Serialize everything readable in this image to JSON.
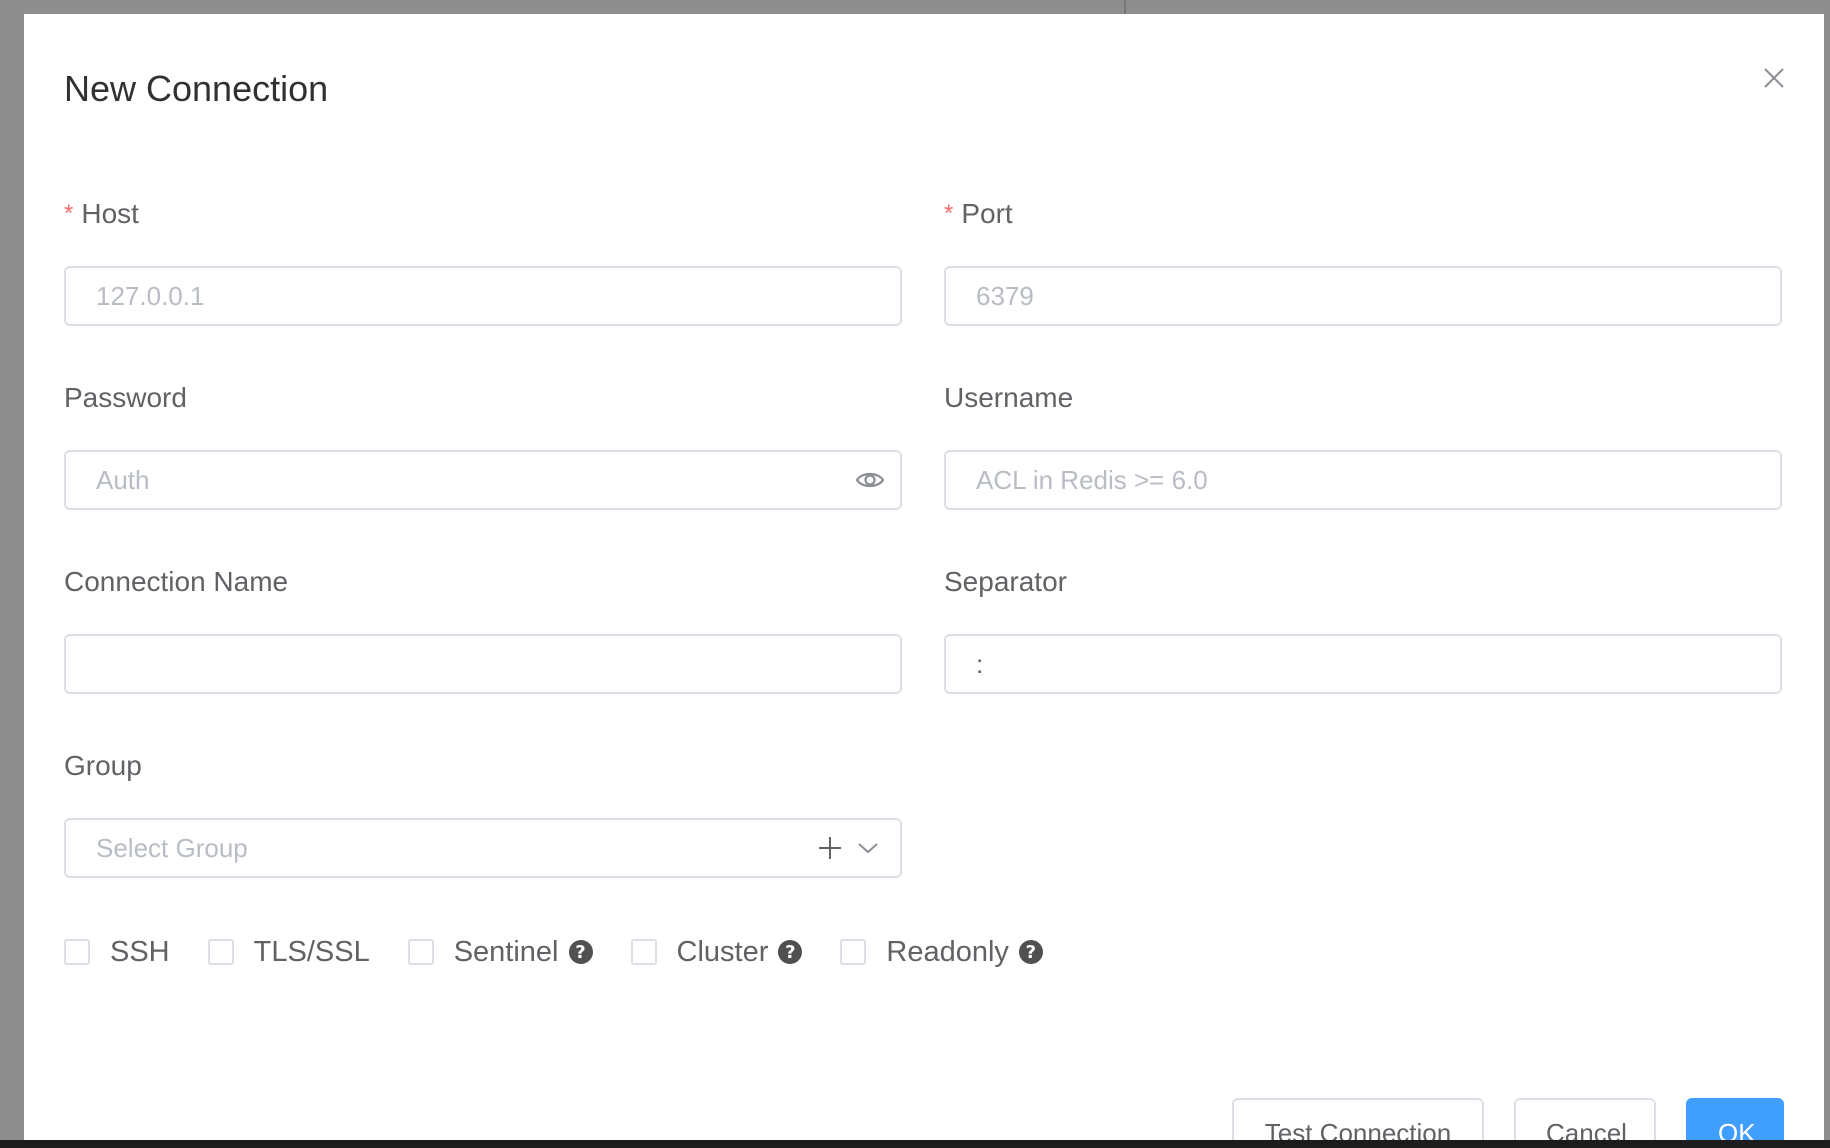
{
  "dialog": {
    "title": "New Connection"
  },
  "fields": {
    "host": {
      "label": "Host",
      "placeholder": "127.0.0.1",
      "value": "",
      "required": true
    },
    "port": {
      "label": "Port",
      "placeholder": "6379",
      "value": "",
      "required": true
    },
    "password": {
      "label": "Password",
      "placeholder": "Auth",
      "value": ""
    },
    "username": {
      "label": "Username",
      "placeholder": "ACL in Redis >= 6.0",
      "value": ""
    },
    "connection_name": {
      "label": "Connection Name",
      "placeholder": "",
      "value": ""
    },
    "separator": {
      "label": "Separator",
      "placeholder": "",
      "value": ":"
    },
    "group": {
      "label": "Group",
      "placeholder": "Select Group",
      "value": ""
    }
  },
  "required_mark": "*",
  "options": {
    "ssh": {
      "label": "SSH",
      "checked": false
    },
    "tls": {
      "label": "TLS/SSL",
      "checked": false
    },
    "sentinel": {
      "label": "Sentinel",
      "checked": false,
      "help": true
    },
    "cluster": {
      "label": "Cluster",
      "checked": false,
      "help": true
    },
    "readonly": {
      "label": "Readonly",
      "checked": false,
      "help": true
    }
  },
  "help_glyph": "?",
  "footer": {
    "test_label": "Test Connection",
    "cancel_label": "Cancel",
    "ok_label": "OK"
  },
  "colors": {
    "primary": "#409eff",
    "required": "#f56c6c",
    "border": "#dcdfe6",
    "label": "#606266",
    "placeholder": "#b8bcc4"
  },
  "icons": {
    "close": "close-icon",
    "password_toggle": "eye-icon",
    "group_add": "plus-icon",
    "group_dropdown": "chevron-down-icon",
    "help": "question-circle-icon"
  }
}
